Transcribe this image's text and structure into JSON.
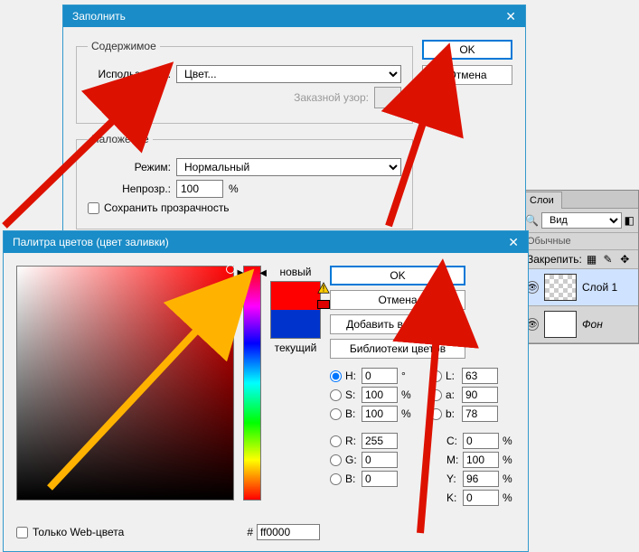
{
  "fill_dialog": {
    "title": "Заполнить",
    "fieldset_content": "Содержимое",
    "use_label": "Использовать:",
    "use_value": "Цвет...",
    "custom_pattern_label": "Заказной узор:",
    "fieldset_blend": "Наложение",
    "mode_label": "Режим:",
    "mode_value": "Нормальный",
    "opacity_label": "Непрозр.:",
    "opacity_value": "100",
    "opacity_unit": "%",
    "preserve_label": "Сохранить прозрачность",
    "ok": "OK",
    "cancel": "Отмена"
  },
  "color_picker": {
    "title": "Палитра цветов (цвет заливки)",
    "new_label": "новый",
    "current_label": "текущий",
    "ok": "OK",
    "cancel": "Отмена",
    "add_swatches": "Добавить в образцы",
    "color_libraries": "Библиотеки цветов",
    "hsb": {
      "H": "0",
      "S": "100",
      "B": "100"
    },
    "lab": {
      "L": "63",
      "a": "90",
      "b": "78"
    },
    "rgb": {
      "R": "255",
      "G": "0",
      "B": "0"
    },
    "cmyk": {
      "C": "0",
      "M": "100",
      "Y": "96",
      "K": "0"
    },
    "hex_label": "#",
    "hex_value": "ff0000",
    "webonly_label": "Только Web-цвета",
    "deg": "°",
    "pct": "%"
  },
  "layers": {
    "tab": "Слои",
    "kind": "Вид",
    "blendmode": "Обычные",
    "lock_label": "Закрепить:",
    "layer1": "Слой 1",
    "bg": "Фон"
  }
}
